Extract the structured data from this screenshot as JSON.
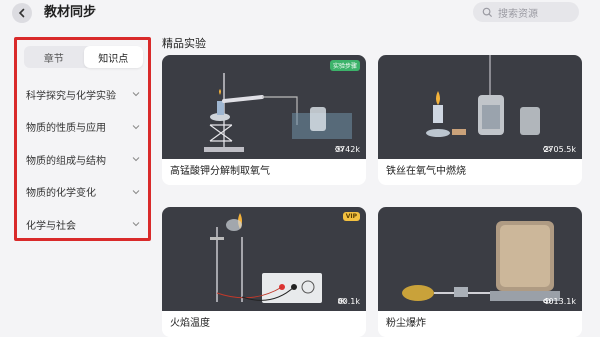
{
  "header": {
    "title": "教材同步",
    "search_placeholder": "搜索资源"
  },
  "sidebar": {
    "tabs": [
      {
        "label": "章节"
      },
      {
        "label": "知识点"
      }
    ],
    "active_tab": "知识点",
    "items": [
      {
        "label": "科学探究与化学实验"
      },
      {
        "label": "物质的性质与应用"
      },
      {
        "label": "物质的组成与结构"
      },
      {
        "label": "物质的化学变化"
      },
      {
        "label": "化学与社会"
      }
    ]
  },
  "main": {
    "section_title": "精品实验",
    "cards": [
      {
        "title": "高锰酸钾分解制取氧气",
        "views": "3742k",
        "badge": "实验步骤"
      },
      {
        "title": "铁丝在氧气中燃烧",
        "views": "2705.5k",
        "badge": ""
      },
      {
        "title": "火焰温度",
        "views": "80.1k",
        "badge": "VIP"
      },
      {
        "title": "粉尘爆炸",
        "views": "4013.1k",
        "badge": ""
      }
    ]
  },
  "colors": {
    "highlight": "#d92a2a",
    "thumb_bg": "#3b3d44",
    "badge_green": "#3cb36a",
    "vip_gold": "#f4c140"
  }
}
